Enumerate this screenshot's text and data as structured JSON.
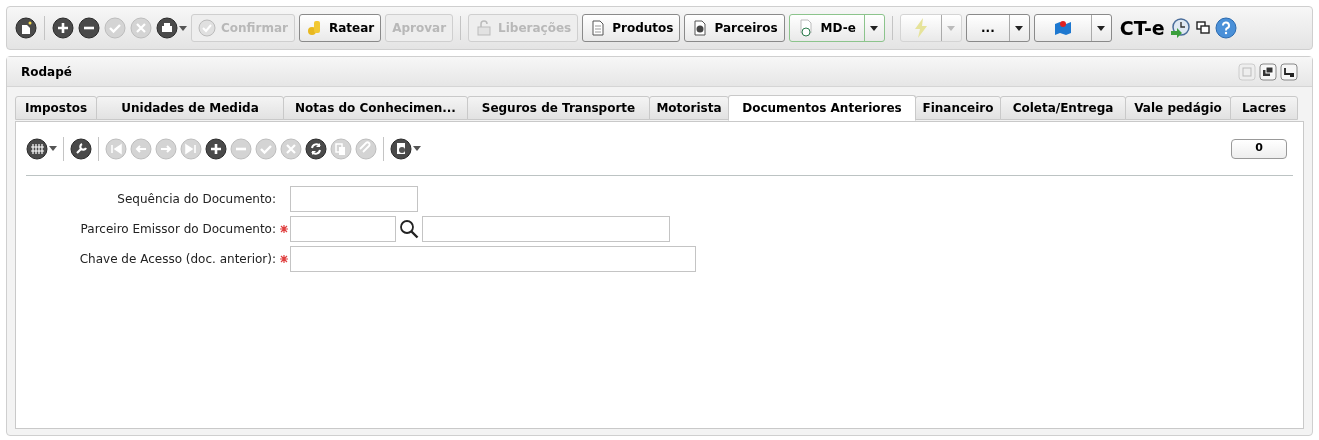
{
  "toolbar": {
    "icon_buttons": [
      {
        "disabled": false
      },
      {
        "disabled": false
      },
      {
        "disabled": false
      },
      {
        "disabled": true
      },
      {
        "disabled": true
      },
      {
        "disabled": false
      }
    ],
    "buttons": [
      {
        "label": "Confirmar",
        "disabled": true
      },
      {
        "label": "Ratear",
        "disabled": false
      },
      {
        "label": "Aprovar",
        "disabled": true
      },
      {
        "label": "Liberações",
        "disabled": true
      },
      {
        "label": "Produtos",
        "disabled": false
      },
      {
        "label": "Parceiros",
        "disabled": false
      }
    ],
    "split_buttons": [
      {
        "label": "MD-e",
        "disabled": false
      },
      {
        "disabled": true
      },
      {
        "label": "...",
        "disabled": false
      },
      {
        "disabled": false
      }
    ],
    "title": "CT-e"
  },
  "panel": {
    "title": "Rodapé",
    "tabs": [
      {
        "label": "Impostos",
        "selected": false
      },
      {
        "label": "Unidades de Medida",
        "selected": false
      },
      {
        "label": "Notas do Conhecimen...",
        "selected": false
      },
      {
        "label": "Seguros de Transporte",
        "selected": false
      },
      {
        "label": "Motorista",
        "selected": false
      },
      {
        "label": "Documentos Anteriores",
        "selected": true
      },
      {
        "label": "Financeiro",
        "selected": false
      },
      {
        "label": "Coleta/Entrega",
        "selected": false
      },
      {
        "label": "Vale pedágio",
        "selected": false
      },
      {
        "label": "Lacres",
        "selected": false
      }
    ],
    "grid_toolbar": [
      {
        "disabled": false
      },
      {
        "disabled": false
      },
      {
        "disabled": true
      },
      {
        "disabled": true
      },
      {
        "disabled": true
      },
      {
        "disabled": true
      },
      {
        "disabled": false
      },
      {
        "disabled": true
      },
      {
        "disabled": true
      },
      {
        "disabled": true
      },
      {
        "disabled": false
      },
      {
        "disabled": true
      },
      {
        "disabled": true
      },
      {
        "disabled": false
      }
    ],
    "record_count": "0",
    "form": [
      {
        "label": "Sequência do Documento:",
        "required": false,
        "kind": "text"
      },
      {
        "label": "Parceiro Emissor do Documento:",
        "required": true,
        "kind": "lookup"
      },
      {
        "label": "Chave de Acesso (doc. anterior):",
        "required": true,
        "kind": "wide"
      }
    ]
  }
}
